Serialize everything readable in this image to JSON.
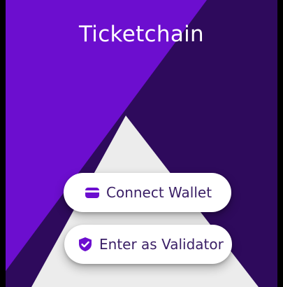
{
  "app": {
    "title": "Ticketchain"
  },
  "actions": {
    "connect_wallet": {
      "label": "Connect Wallet",
      "icon": "wallet-icon"
    },
    "enter_validator": {
      "label": "Enter as Validator",
      "icon": "shield-check-icon"
    }
  },
  "theme": {
    "primary_purple": "#6c0ecf",
    "dark_purple": "#2e0a5c",
    "light_gray": "#ececec",
    "button_text": "#3a1f66",
    "icon_color": "#6c0ecf"
  }
}
